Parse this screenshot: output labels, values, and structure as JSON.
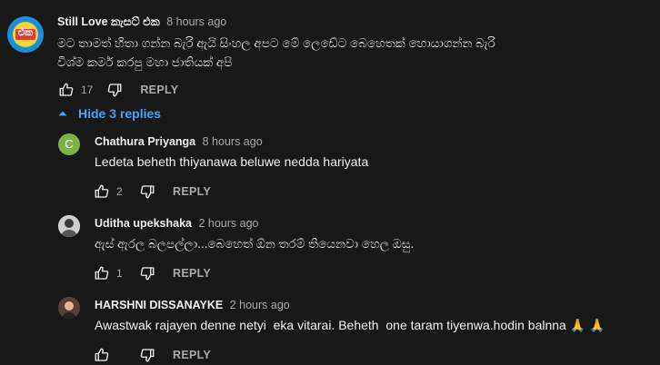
{
  "comment": {
    "author": "Still Love කැසට් එක",
    "time": "8 hours ago",
    "avatar_text": "එක",
    "text_line1": "මට තාමත් හිතා ගන්න බැරි ඇයි සිංහල අපට මේ ලෙඩේට බෙහෙතක් හොයාගන්න බැරි",
    "text_line2": "විශ්ම කර්ම කරපු මහා ජාතියක් අපි",
    "likes": "17",
    "reply_label": "REPLY"
  },
  "replies_toggle": {
    "label": "Hide 3 replies"
  },
  "replies": [
    {
      "author": "Chathura Priyanga",
      "time": "8 hours ago",
      "avatar_letter": "C",
      "text": "Ledeta beheth thiyanawa beluwe nedda hariyata",
      "likes": "2",
      "reply_label": "REPLY"
    },
    {
      "author": "Uditha upekshaka",
      "time": "2 hours ago",
      "text": "ඇස් ඇරල බලපල්ලා...බෙහෙත් ඕන තරම් තියෙනවා හෙල ඔසු.",
      "likes": "1",
      "reply_label": "REPLY"
    },
    {
      "author": "HARSHNI DISSANAYKE",
      "time": "2 hours ago",
      "text": "Awastwak rajayen denne netyi  eka vitarai. Beheth  one taram tiyenwa.hodin balnna 🙏 🙏",
      "likes": "",
      "reply_label": "REPLY"
    }
  ],
  "colors": {
    "background": "#181818",
    "link_blue": "#3ea6ff",
    "muted": "#aaaaaa",
    "avatar_c": "#7cb342"
  }
}
